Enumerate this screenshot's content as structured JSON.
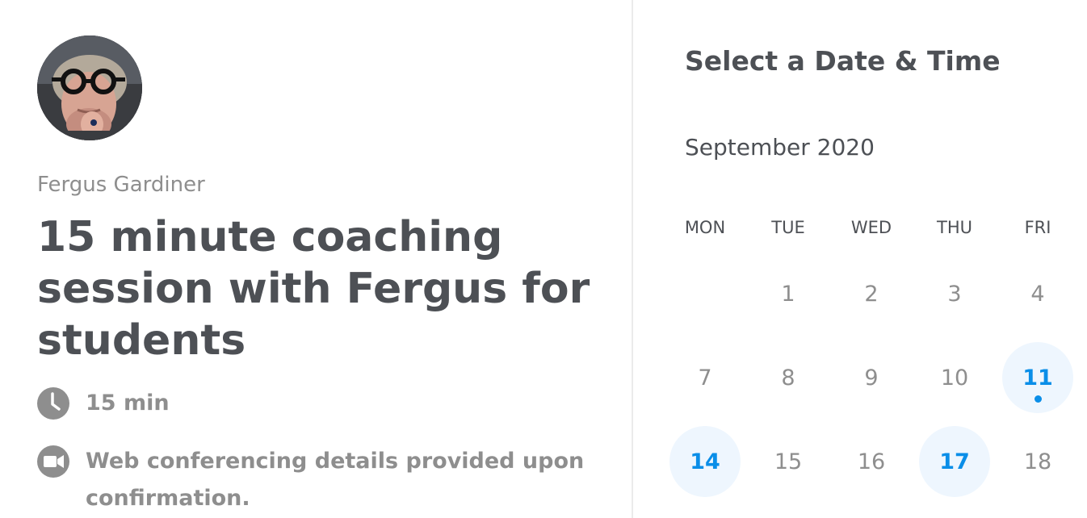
{
  "host": {
    "name": "Fergus Gardiner"
  },
  "event": {
    "title": "15 minute coaching session with Fergus for students",
    "duration": "15 min",
    "duration_icon": "clock-icon",
    "conferencing": "Web conferencing details provided upon confirmation.",
    "conferencing_icon": "video-camera-icon"
  },
  "scheduler": {
    "title": "Select a Date & Time",
    "month": "September 2020",
    "weekdays": [
      "MON",
      "TUE",
      "WED",
      "THU",
      "FRI"
    ],
    "weeks": [
      [
        {
          "day": "",
          "available": false,
          "selected": false
        },
        {
          "day": "1",
          "available": false,
          "selected": false
        },
        {
          "day": "2",
          "available": false,
          "selected": false
        },
        {
          "day": "3",
          "available": false,
          "selected": false
        },
        {
          "day": "4",
          "available": false,
          "selected": false
        }
      ],
      [
        {
          "day": "7",
          "available": false,
          "selected": false
        },
        {
          "day": "8",
          "available": false,
          "selected": false
        },
        {
          "day": "9",
          "available": false,
          "selected": false
        },
        {
          "day": "10",
          "available": false,
          "selected": false
        },
        {
          "day": "11",
          "available": true,
          "selected": true
        }
      ],
      [
        {
          "day": "14",
          "available": true,
          "selected": false
        },
        {
          "day": "15",
          "available": false,
          "selected": false
        },
        {
          "day": "16",
          "available": false,
          "selected": false
        },
        {
          "day": "17",
          "available": true,
          "selected": false
        },
        {
          "day": "18",
          "available": false,
          "selected": false
        }
      ]
    ]
  },
  "colors": {
    "accent": "#0a8ee8",
    "available_bg": "#eef6fe",
    "text_primary": "#4d5055",
    "text_muted": "#8e8e8e",
    "divider": "#ebebeb"
  }
}
